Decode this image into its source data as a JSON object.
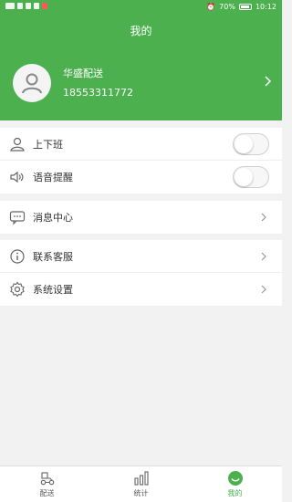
{
  "status_bar": {
    "battery": "70%",
    "time": "10:12"
  },
  "header": {
    "title": "我的"
  },
  "profile": {
    "name": "华盛配送",
    "phone": "18553311772"
  },
  "group1": [
    {
      "label": "上下班",
      "toggle": false
    },
    {
      "label": "语音提醒",
      "toggle": false
    }
  ],
  "group2": [
    {
      "label": "消息中心"
    }
  ],
  "group3": [
    {
      "label": "联系客服"
    },
    {
      "label": "系统设置"
    }
  ],
  "tabs": [
    {
      "label": "配送",
      "icon": "delivery-icon",
      "active": false
    },
    {
      "label": "统计",
      "icon": "statistics-icon",
      "active": false
    },
    {
      "label": "我的",
      "icon": "profile-icon",
      "active": true
    }
  ],
  "colors": {
    "accent": "#4db04f",
    "background": "#f2f2f2"
  }
}
